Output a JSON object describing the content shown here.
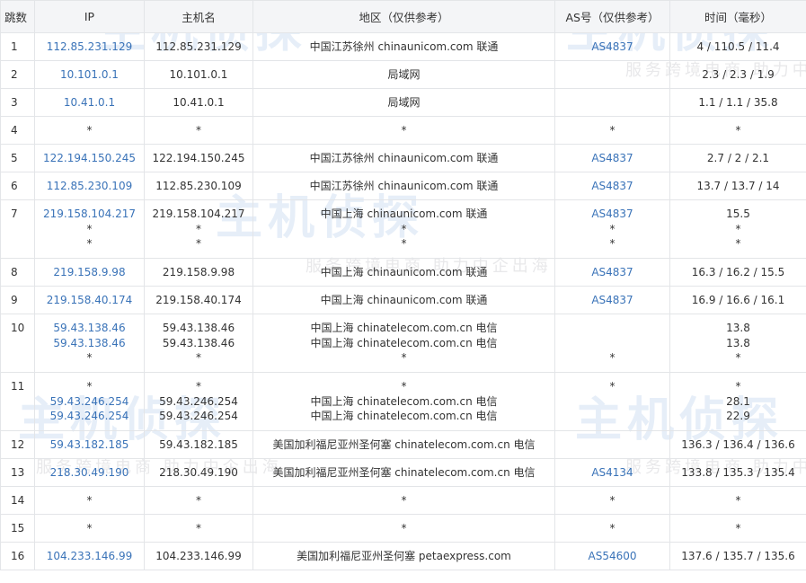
{
  "headers": {
    "hop": "跳数",
    "ip": "IP",
    "host": "主机名",
    "region": "地区（仅供参考）",
    "as": "AS号（仅供参考）",
    "time": "时间（毫秒）"
  },
  "watermark": {
    "brand": "主机侦探",
    "slogan": "服务跨境电商 助力中企出海"
  },
  "rows": [
    {
      "hop": "1",
      "lines": [
        {
          "ip": "112.85.231.129",
          "host": "112.85.231.129",
          "region": "中国江苏徐州 chinaunicom.com 联通",
          "as": "AS4837",
          "time": "4 / 110.5 / 11.4"
        }
      ]
    },
    {
      "hop": "2",
      "lines": [
        {
          "ip": "10.101.0.1",
          "host": "10.101.0.1",
          "region": "局域网",
          "as": "",
          "time": "2.3 / 2.3 / 1.9"
        }
      ]
    },
    {
      "hop": "3",
      "lines": [
        {
          "ip": "10.41.0.1",
          "host": "10.41.0.1",
          "region": "局域网",
          "as": "",
          "time": "1.1 / 1.1 / 35.8"
        }
      ]
    },
    {
      "hop": "4",
      "lines": [
        {
          "ip": "*",
          "host": "*",
          "region": "*",
          "as": "*",
          "time": "*"
        }
      ]
    },
    {
      "hop": "5",
      "lines": [
        {
          "ip": "122.194.150.245",
          "host": "122.194.150.245",
          "region": "中国江苏徐州 chinaunicom.com 联通",
          "as": "AS4837",
          "time": "2.7 / 2 / 2.1"
        }
      ]
    },
    {
      "hop": "6",
      "lines": [
        {
          "ip": "112.85.230.109",
          "host": "112.85.230.109",
          "region": "中国江苏徐州 chinaunicom.com 联通",
          "as": "AS4837",
          "time": "13.7 / 13.7 / 14"
        }
      ]
    },
    {
      "hop": "7",
      "lines": [
        {
          "ip": "219.158.104.217",
          "host": "219.158.104.217",
          "region": "中国上海 chinaunicom.com 联通",
          "as": "AS4837",
          "time": "15.5"
        },
        {
          "ip": "*",
          "host": "*",
          "region": "*",
          "as": "*",
          "time": "*"
        },
        {
          "ip": "*",
          "host": "*",
          "region": "*",
          "as": "*",
          "time": "*"
        }
      ]
    },
    {
      "hop": "8",
      "lines": [
        {
          "ip": "219.158.9.98",
          "host": "219.158.9.98",
          "region": "中国上海 chinaunicom.com 联通",
          "as": "AS4837",
          "time": "16.3 / 16.2 / 15.5"
        }
      ]
    },
    {
      "hop": "9",
      "lines": [
        {
          "ip": "219.158.40.174",
          "host": "219.158.40.174",
          "region": "中国上海 chinaunicom.com 联通",
          "as": "AS4837",
          "time": "16.9 / 16.6 / 16.1"
        }
      ]
    },
    {
      "hop": "10",
      "lines": [
        {
          "ip": "59.43.138.46",
          "host": "59.43.138.46",
          "region": "中国上海 chinatelecom.com.cn 电信",
          "as": "",
          "time": "13.8"
        },
        {
          "ip": "59.43.138.46",
          "host": "59.43.138.46",
          "region": "中国上海 chinatelecom.com.cn 电信",
          "as": "",
          "time": "13.8"
        },
        {
          "ip": "*",
          "host": "*",
          "region": "*",
          "as": "*",
          "time": "*"
        }
      ]
    },
    {
      "hop": "11",
      "lines": [
        {
          "ip": "*",
          "host": "*",
          "region": "*",
          "as": "*",
          "time": "*"
        },
        {
          "ip": "59.43.246.254",
          "host": "59.43.246.254",
          "region": "中国上海 chinatelecom.com.cn 电信",
          "as": "",
          "time": "28.1"
        },
        {
          "ip": "59.43.246.254",
          "host": "59.43.246.254",
          "region": "中国上海 chinatelecom.com.cn 电信",
          "as": "",
          "time": "22.9"
        }
      ]
    },
    {
      "hop": "12",
      "lines": [
        {
          "ip": "59.43.182.185",
          "host": "59.43.182.185",
          "region": "美国加利福尼亚州圣何塞 chinatelecom.com.cn 电信",
          "as": "",
          "time": "136.3 / 136.4 / 136.6"
        }
      ]
    },
    {
      "hop": "13",
      "lines": [
        {
          "ip": "218.30.49.190",
          "host": "218.30.49.190",
          "region": "美国加利福尼亚州圣何塞 chinatelecom.com.cn 电信",
          "as": "AS4134",
          "time": "133.8 / 135.3 / 135.4"
        }
      ]
    },
    {
      "hop": "14",
      "lines": [
        {
          "ip": "*",
          "host": "*",
          "region": "*",
          "as": "*",
          "time": "*"
        }
      ]
    },
    {
      "hop": "15",
      "lines": [
        {
          "ip": "*",
          "host": "*",
          "region": "*",
          "as": "*",
          "time": "*"
        }
      ]
    },
    {
      "hop": "16",
      "lines": [
        {
          "ip": "104.233.146.99",
          "host": "104.233.146.99",
          "region": "美国加利福尼亚州圣何塞 petaexpress.com",
          "as": "AS54600",
          "time": "137.6 / 135.7 / 135.6"
        }
      ]
    }
  ]
}
